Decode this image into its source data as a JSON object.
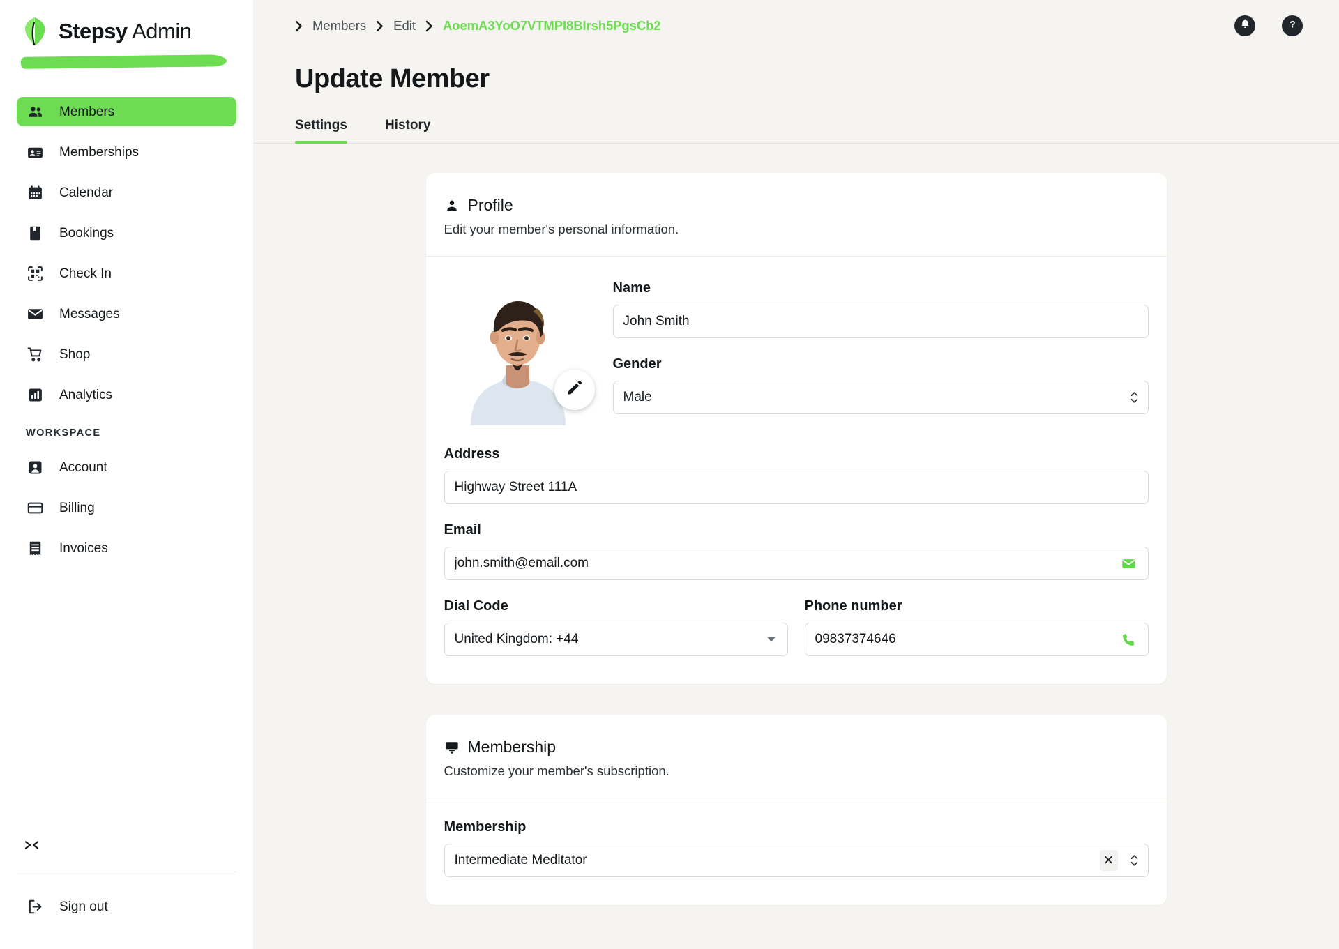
{
  "brand": {
    "name_bold": "Stepsy",
    "name_light": "Admin"
  },
  "sidebar": {
    "items": [
      {
        "label": "Members",
        "icon": "people-icon",
        "active": true
      },
      {
        "label": "Memberships",
        "icon": "id-card-icon",
        "active": false
      },
      {
        "label": "Calendar",
        "icon": "calendar-icon",
        "active": false
      },
      {
        "label": "Bookings",
        "icon": "bookmark-icon",
        "active": false
      },
      {
        "label": "Check In",
        "icon": "qr-code-icon",
        "active": false
      },
      {
        "label": "Messages",
        "icon": "envelope-icon",
        "active": false
      },
      {
        "label": "Shop",
        "icon": "cart-icon",
        "active": false
      },
      {
        "label": "Analytics",
        "icon": "bar-chart-icon",
        "active": false
      }
    ],
    "section_label": "WORKSPACE",
    "workspace_items": [
      {
        "label": "Account",
        "icon": "account-icon"
      },
      {
        "label": "Billing",
        "icon": "credit-card-icon"
      },
      {
        "label": "Invoices",
        "icon": "receipt-icon"
      }
    ],
    "collapse_label": "›‹",
    "signout_label": "Sign out"
  },
  "topbar": {
    "breadcrumbs": [
      {
        "label": "Members",
        "current": false
      },
      {
        "label": "Edit",
        "current": false
      },
      {
        "label": "AoemA3YoO7VTMPI8BIrsh5PgsCb2",
        "current": true
      }
    ],
    "notifications_icon": "bell-icon",
    "help_icon": "question-mark-icon"
  },
  "page": {
    "title": "Update Member",
    "tabs": [
      {
        "label": "Settings",
        "active": true
      },
      {
        "label": "History",
        "active": false
      }
    ]
  },
  "profile_card": {
    "icon": "person-icon",
    "title": "Profile",
    "subtitle": "Edit your member's personal information.",
    "avatar_alt": "member-photo",
    "edit_icon": "pencil-icon",
    "fields": {
      "name": {
        "label": "Name",
        "value": "John Smith",
        "placeholder": "Name"
      },
      "gender": {
        "label": "Gender",
        "value": "Male",
        "placeholder": "Gender"
      },
      "address": {
        "label": "Address",
        "value": "Highway Street 111A",
        "placeholder": "Address"
      },
      "email": {
        "label": "Email",
        "value": "john.smith@email.com",
        "placeholder": "Email",
        "icon": "mail-icon"
      },
      "dial": {
        "label": "Dial Code",
        "value": "United Kingdom: +44",
        "placeholder": "Dial Code"
      },
      "phone": {
        "label": "Phone number",
        "value": "09837374646",
        "placeholder": "Phone number",
        "icon": "phone-icon"
      }
    }
  },
  "membership_card": {
    "icon": "membership-icon",
    "title": "Membership",
    "subtitle": "Customize your member's subscription.",
    "fields": {
      "membership": {
        "label": "Membership",
        "value": "Intermediate Meditator",
        "placeholder": "Membership",
        "clear_label": "✕"
      }
    }
  },
  "colors": {
    "accent": "#6EDC53",
    "page_bg": "#F5F4F0",
    "sidebar_bg": "#FFFFFF",
    "text": "#14181A"
  }
}
